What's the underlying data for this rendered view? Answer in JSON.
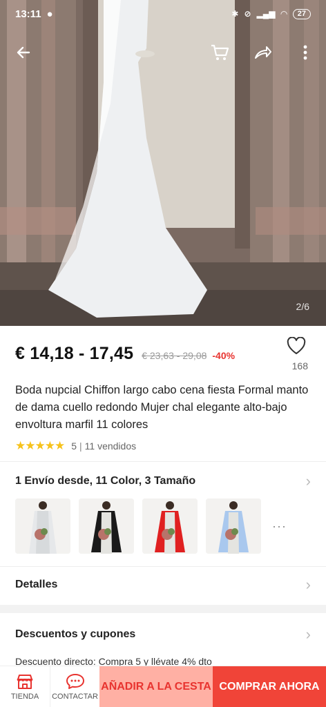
{
  "status": {
    "time": "13:11",
    "battery": "27"
  },
  "hero": {
    "page_indicator": "2/6"
  },
  "product": {
    "price": "€ 14,18 - 17,45",
    "old_price": "€ 23,63 - 29,08",
    "discount": "-40%",
    "wishlist_count": "168",
    "title": "Boda nupcial Chiffon largo cabo cena fiesta Formal manto de dama cuello redondo Mujer chal elegante alto-bajo envoltura marfil 11 colores",
    "rating": "5",
    "sold": "11 vendidos"
  },
  "options": {
    "summary": "1 Envío desde, 11 Color, 3 Tamaño",
    "variants": [
      {
        "name": "white-variant",
        "cape_color": "#ffffff"
      },
      {
        "name": "black-variant",
        "cape_color": "#1a1a1a"
      },
      {
        "name": "red-variant",
        "cape_color": "#e02020"
      },
      {
        "name": "lightblue-variant",
        "cape_color": "#a9c8ee"
      }
    ],
    "more": "···"
  },
  "details_label": "Detalles",
  "coupons": {
    "label": "Descuentos y cupones",
    "text": "Descuento directo: Compra 5 y llévate 4% dto"
  },
  "bottom_bar": {
    "store_label": "TIENDA",
    "contact_label": "CONTACTAR",
    "add_to_cart": "AÑADIR A LA CESTA",
    "buy_now": "COMPRAR AHORA"
  }
}
